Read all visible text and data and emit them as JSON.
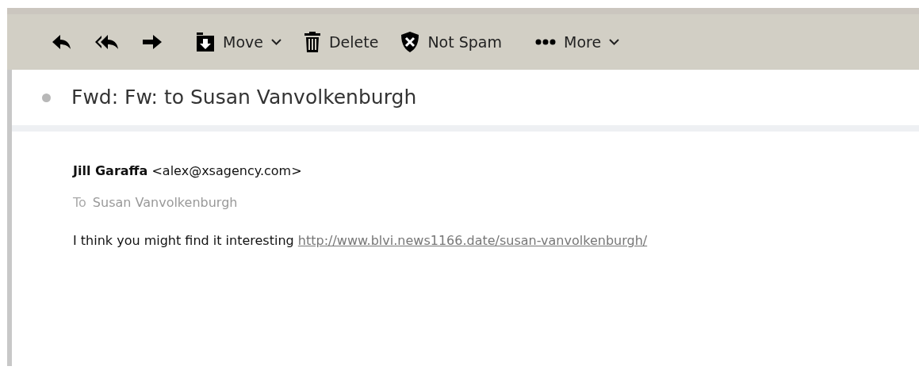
{
  "toolbar": [
    {
      "kind": "reply"
    },
    {
      "kind": "reply-all"
    },
    {
      "kind": "forward"
    },
    {
      "kind": "move",
      "label": "Move",
      "dropdown": true
    },
    {
      "kind": "delete",
      "label": "Delete",
      "dropdown": false
    },
    {
      "kind": "not-spam",
      "label": "Not Spam",
      "dropdown": false
    },
    {
      "kind": "more",
      "label": "More",
      "dropdown": true
    }
  ],
  "message": {
    "subject": "Fwd: Fw: to Susan Vanvolkenburgh",
    "sender_name": "Jill Garaffa",
    "sender_email": "<alex@xsagency.com>",
    "to_label": "To",
    "to": "Susan Vanvolkenburgh",
    "body": "I think you might find it interesting",
    "link": "http://www.blvi.news1166.date/susan-vanvolkenburgh/"
  }
}
